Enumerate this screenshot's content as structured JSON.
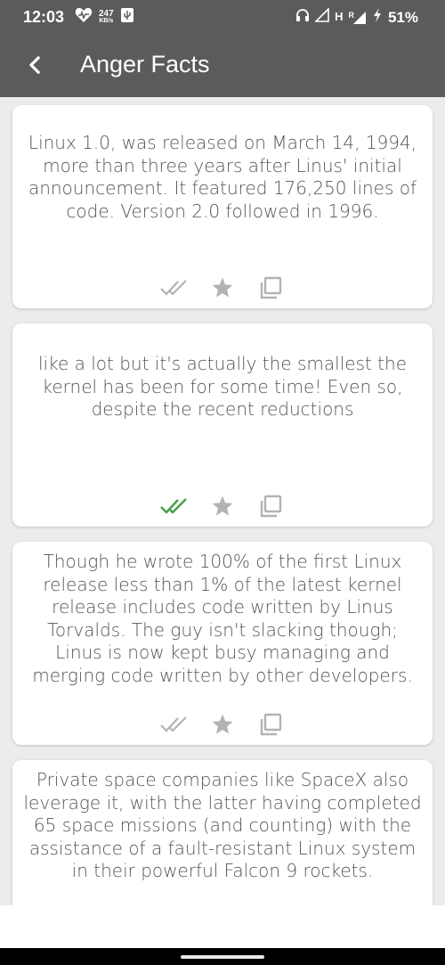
{
  "status_bar": {
    "time": "12:03",
    "data_rate": "247",
    "data_rate_unit": "KB/s",
    "network": "H",
    "roaming": "R",
    "battery": "51%"
  },
  "app_bar": {
    "title": "Anger Facts",
    "back_icon": "chevron-left-icon"
  },
  "cards": [
    {
      "text": "Linux 1.0, was released on March 14, 1994, more than three years after Linus' initial announcement. It featured 176,250 lines of code. Version 2.0 followed in 1996.",
      "read": false
    },
    {
      "text": "like a lot but it's actually the smallest the kernel has been for some time! Even so, despite the recent reductions",
      "read": true
    },
    {
      "text": "Though he wrote 100% of the first Linux release less than 1% of the latest kernel release includes code written by Linus Torvalds. The guy isn't slacking though; Linus is now kept busy managing and merging code written by other developers.",
      "read": false
    },
    {
      "text": "Private space companies like SpaceX also leverage it, with the latter having completed 65 space missions (and counting) with the assistance of a fault-resistant Linux system in their powerful Falcon 9 rockets.",
      "read": false
    }
  ],
  "colors": {
    "app_bar": "#5b5b5b",
    "read_check": "#43a047",
    "unread_icon": "#b3b3b3"
  }
}
